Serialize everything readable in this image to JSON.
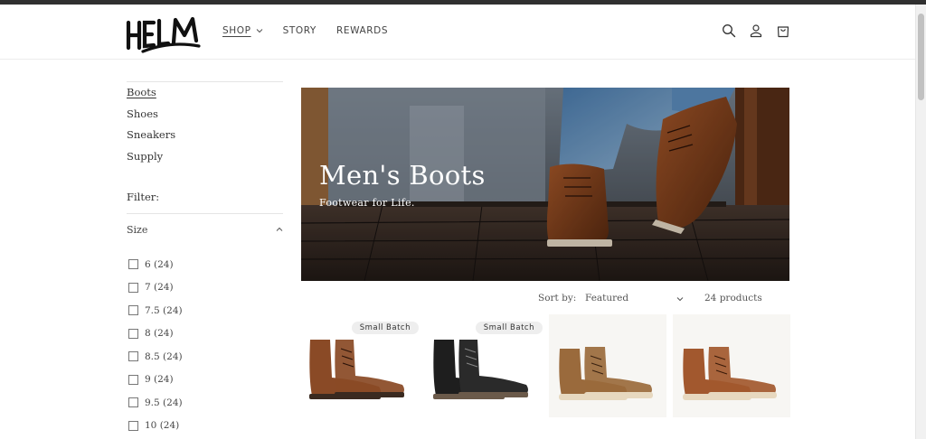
{
  "header": {
    "brand": "HELM",
    "nav": [
      {
        "label": "SHOP",
        "active": true,
        "has_dropdown": true
      },
      {
        "label": "STORY",
        "active": false,
        "has_dropdown": false
      },
      {
        "label": "REWARDS",
        "active": false,
        "has_dropdown": false
      }
    ],
    "icons": [
      "search-icon",
      "account-icon",
      "cart-icon"
    ]
  },
  "sidebar": {
    "categories": [
      "Boots",
      "Shoes",
      "Sneakers",
      "Supply"
    ],
    "active_category": "Boots",
    "filter_label": "Filter:",
    "size_filter": {
      "label": "Size",
      "expanded": true,
      "options": [
        "6 (24)",
        "7 (24)",
        "7.5 (24)",
        "8 (24)",
        "8.5 (24)",
        "9 (24)",
        "9.5 (24)",
        "10 (24)"
      ]
    }
  },
  "hero": {
    "title": "Men's Boots",
    "subtitle": "Footwear for Life."
  },
  "sort": {
    "label": "Sort by:",
    "selected": "Featured",
    "count": "24 products"
  },
  "products": [
    {
      "badge": "Small Batch",
      "color": "#8a4a26"
    },
    {
      "badge": "Small Batch",
      "color": "#1e1e1e"
    },
    {
      "badge": "",
      "color": "#9a6a3c"
    },
    {
      "badge": "",
      "color": "#a2582e"
    }
  ],
  "colors": {
    "topbar": "#303030",
    "text": "#333333"
  }
}
